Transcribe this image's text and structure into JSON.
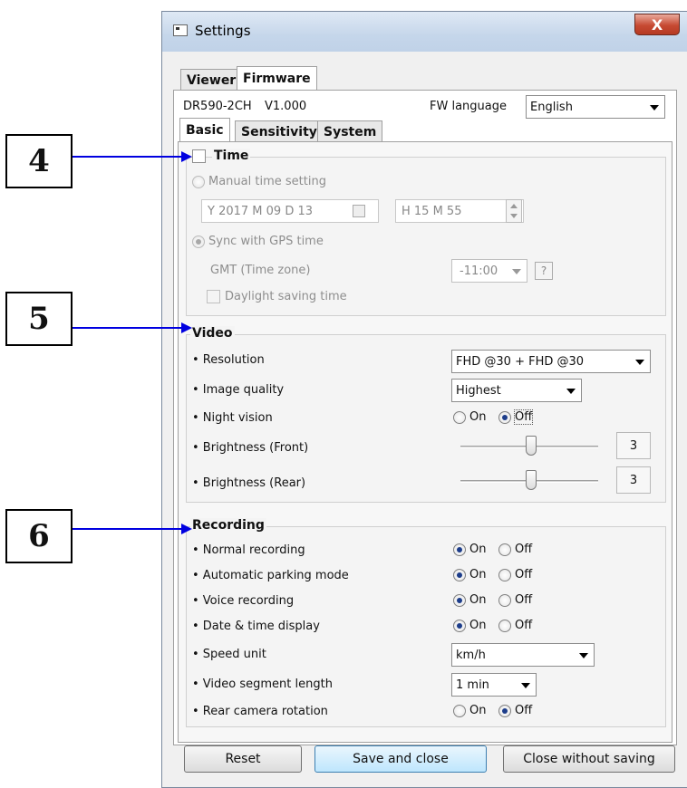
{
  "window": {
    "title": "Settings",
    "close_glyph": "X"
  },
  "tabs": {
    "top": [
      "Viewer",
      "Firmware"
    ],
    "sub": [
      "Basic",
      "Sensitivity",
      "System"
    ]
  },
  "device": {
    "model": "DR590-2CH",
    "version": "V1.000",
    "fw_language_label": "FW language",
    "fw_language_value": "English"
  },
  "callouts": [
    "4",
    "5",
    "6"
  ],
  "time": {
    "title": "Time",
    "manual_label": "Manual time setting",
    "date_value": "Y 2017 M 09 D 13",
    "time_value": "H 15 M 55",
    "sync_label": "Sync with GPS time",
    "gmt_label": "GMT  (Time zone)",
    "gmt_value": "-11:00",
    "help_glyph": "?",
    "dst_label": "Daylight saving time"
  },
  "video": {
    "title": "Video",
    "resolution_label": "• Resolution",
    "resolution_value": "FHD @30 + FHD @30",
    "quality_label": "• Image quality",
    "quality_value": "Highest",
    "night_label": "• Night vision",
    "on_label": "On",
    "off_label": "Off",
    "night_value": "Off",
    "bright_front_label": "• Brightness (Front)",
    "bright_front_value": "3",
    "bright_rear_label": "• Brightness (Rear)",
    "bright_rear_value": "3"
  },
  "recording": {
    "title": "Recording",
    "on_label": "On",
    "off_label": "Off",
    "rows": [
      {
        "label": "• Normal recording",
        "value": "On"
      },
      {
        "label": "• Automatic parking mode",
        "value": "On"
      },
      {
        "label": "• Voice recording",
        "value": "On"
      },
      {
        "label": "• Date & time display",
        "value": "On"
      }
    ],
    "speed_label": "• Speed unit",
    "speed_value": "km/h",
    "segment_label": "• Video segment length",
    "segment_value": "1 min",
    "rear_rotation_label": "• Rear camera rotation",
    "rear_rotation_value": "Off"
  },
  "buttons": {
    "reset": "Reset",
    "save": "Save and close",
    "close": "Close without saving"
  },
  "colors": {
    "arrow": "#0000e0",
    "radio_selected": "#1d3d8a"
  }
}
